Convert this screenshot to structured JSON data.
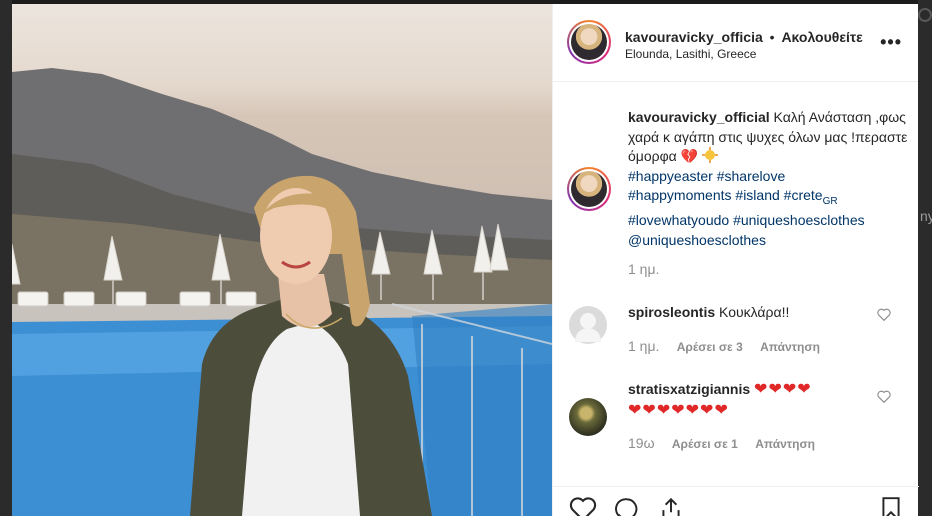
{
  "post": {
    "username": "kavouravicky_officia",
    "follow_status": "Ακολουθείτε",
    "separator": "•",
    "location": "Elounda, Lasithi, Greece",
    "more_label": "•••",
    "caption": {
      "username": "kavouravicky_official",
      "text": "Καλή Ανάσταση ,φως χαρά κ αγάπη στις ψυχες όλων μας !περαστε όμορφα",
      "emojis": "💔",
      "hashtags": [
        "#happyeaster",
        "#sharelove",
        "#happymoments",
        "#island",
        "#crete",
        "#lovewhatyoudo",
        "#uniqueshoesclothes"
      ],
      "crete_suffix": "GR",
      "mention": "@uniqueshoesclothes"
    },
    "time": "1 ημ."
  },
  "comments": [
    {
      "username": "spirosleontis",
      "text": "Κουκλάρα!!",
      "time": "1 ημ.",
      "likes": "Αρέσει σε 3",
      "reply": "Απάντηση"
    },
    {
      "username": "stratisxatzigiannis",
      "text_line1": "❤❤❤❤",
      "text_line2": "❤❤❤❤❤❤❤",
      "time": "19ω",
      "likes": "Αρέσει σε 1",
      "reply": "Απάντηση"
    }
  ],
  "background": {
    "ghost_text": "ny"
  },
  "colors": {
    "link": "#003569",
    "text": "#262626",
    "muted": "#8e8e8e",
    "heart": "#e02828"
  }
}
